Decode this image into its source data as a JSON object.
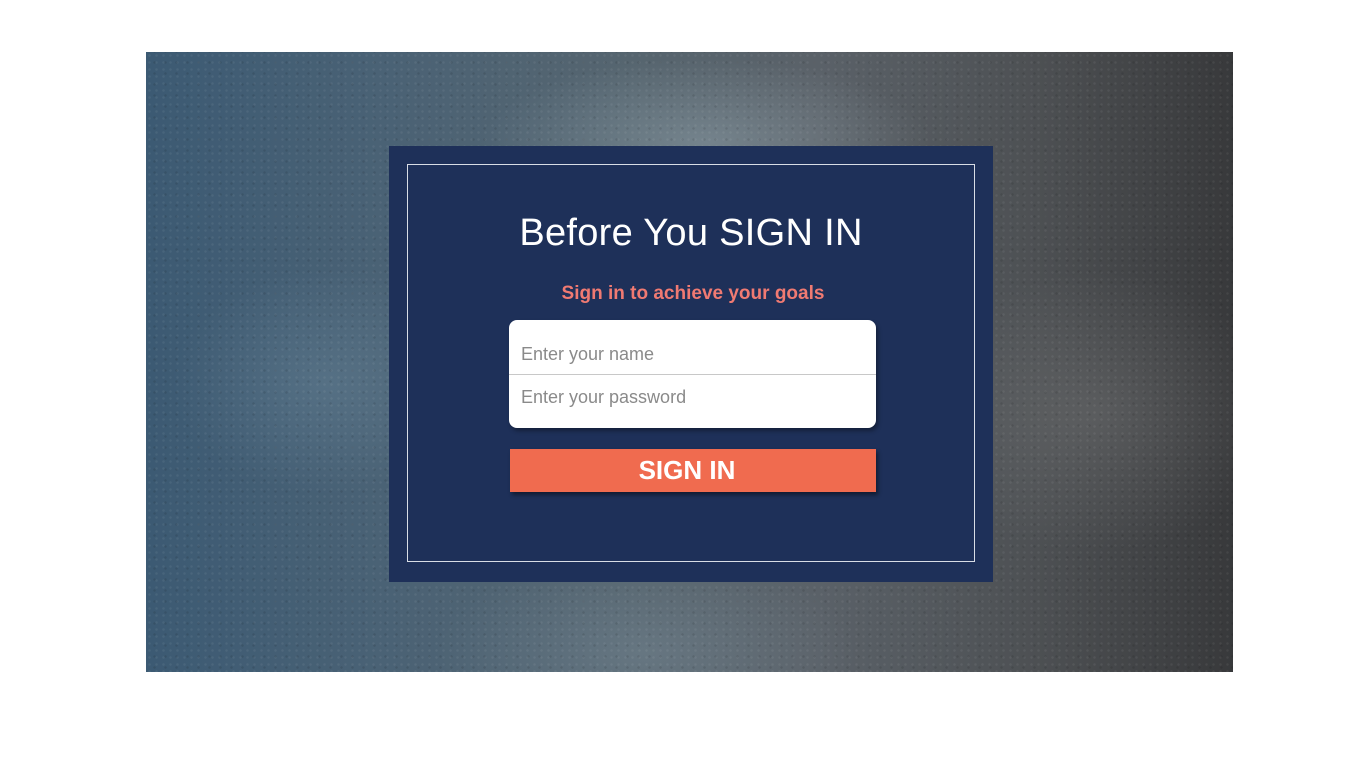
{
  "login": {
    "title": "Before You SIGN IN",
    "subtitle": "Sign in to achieve your goals",
    "name_placeholder": "Enter your name",
    "password_placeholder": "Enter your password",
    "name_value": "",
    "password_value": "",
    "signin_label": "SIGN IN"
  },
  "colors": {
    "card_background": "#1e3059",
    "subtitle": "#f07a72",
    "button": "#f06b4f",
    "title": "#ffffff"
  }
}
